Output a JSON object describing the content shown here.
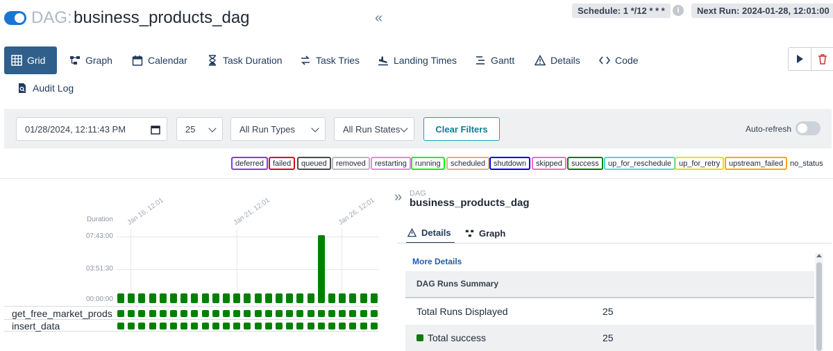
{
  "header": {
    "dag_prefix": "DAG:",
    "dag_name": "business_products_dag",
    "schedule": "Schedule: 1 */12 * * *",
    "next_run": "Next Run: 2024-01-28, 12:01:00"
  },
  "tabs": [
    {
      "label": "Grid",
      "icon": "grid-icon",
      "active": true
    },
    {
      "label": "Graph",
      "icon": "graph-icon"
    },
    {
      "label": "Calendar",
      "icon": "calendar-icon"
    },
    {
      "label": "Task Duration",
      "icon": "hourglass-icon"
    },
    {
      "label": "Task Tries",
      "icon": "retry-icon"
    },
    {
      "label": "Landing Times",
      "icon": "landing-icon"
    },
    {
      "label": "Gantt",
      "icon": "gantt-icon"
    },
    {
      "label": "Details",
      "icon": "warning-icon"
    },
    {
      "label": "Code",
      "icon": "code-icon"
    },
    {
      "label": "Audit Log",
      "icon": "audit-icon"
    }
  ],
  "filters": {
    "date": "01/28/2024, 12:11:43 PM",
    "count": "25",
    "run_types": "All Run Types",
    "run_states": "All Run States",
    "clear": "Clear Filters",
    "auto_refresh": "Auto-refresh"
  },
  "legend": [
    {
      "label": "deferred",
      "color": "#7b3fe4"
    },
    {
      "label": "failed",
      "color": "#e0001a"
    },
    {
      "label": "queued",
      "color": "#4b4b4b"
    },
    {
      "label": "removed",
      "color": "#b8b8b8"
    },
    {
      "label": "restarting",
      "color": "#ee82ee"
    },
    {
      "label": "running",
      "color": "#00ff00"
    },
    {
      "label": "scheduled",
      "color": "#d2b48c"
    },
    {
      "label": "shutdown",
      "color": "#0000ff"
    },
    {
      "label": "skipped",
      "color": "#ff69b4"
    },
    {
      "label": "success",
      "color": "#008000"
    },
    {
      "label": "up_for_reschedule",
      "color": "#40e0d0"
    },
    {
      "label": "up_for_retry",
      "color": "#ffd700"
    },
    {
      "label": "upstream_failed",
      "color": "#ffa500"
    },
    {
      "label": "no_status",
      "color": ""
    }
  ],
  "grid": {
    "duration_label": "Duration",
    "y_ticks": [
      "07:43:00",
      "03:51:30",
      "00:00:00"
    ],
    "x_labels": [
      "Jan 16, 12:01",
      "Jan 21, 12:01",
      "Jan 26, 12:01"
    ],
    "tasks": [
      "get_free_market_prods",
      "insert_data"
    ],
    "runs": 25,
    "tall_run_index": 19,
    "tall_run_fraction": 0.98,
    "run_status_color": "#008000"
  },
  "details": {
    "label": "DAG",
    "name": "business_products_dag",
    "tabs": [
      "Details",
      "Graph"
    ],
    "more_details": "More Details",
    "summary_title": "DAG Runs Summary",
    "rows": [
      {
        "key": "Total Runs Displayed",
        "value": "25"
      },
      {
        "key": "Total success",
        "value": "25"
      }
    ]
  }
}
